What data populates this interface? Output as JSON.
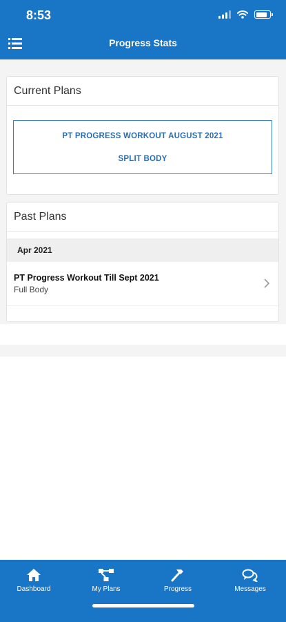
{
  "status_bar": {
    "time": "8:53"
  },
  "header": {
    "title": "Progress Stats"
  },
  "current_plans": {
    "title": "Current Plans",
    "plan": {
      "name": "PT PROGRESS WORKOUT AUGUST 2021",
      "type": "SPLIT BODY"
    }
  },
  "past_plans": {
    "title": "Past Plans",
    "groups": [
      {
        "label": "Apr 2021",
        "items": [
          {
            "name": "PT Progress Workout Till Sept 2021",
            "type": "Full Body"
          }
        ]
      }
    ]
  },
  "tabs": [
    {
      "label": "Dashboard",
      "icon": "home-icon"
    },
    {
      "label": "My Plans",
      "icon": "plans-icon"
    },
    {
      "label": "Progress",
      "icon": "hammer-icon"
    },
    {
      "label": "Messages",
      "icon": "messages-icon"
    }
  ],
  "colors": {
    "primary": "#1976c7",
    "accent_text": "#2a6db5",
    "background": "#f4f4f4"
  }
}
